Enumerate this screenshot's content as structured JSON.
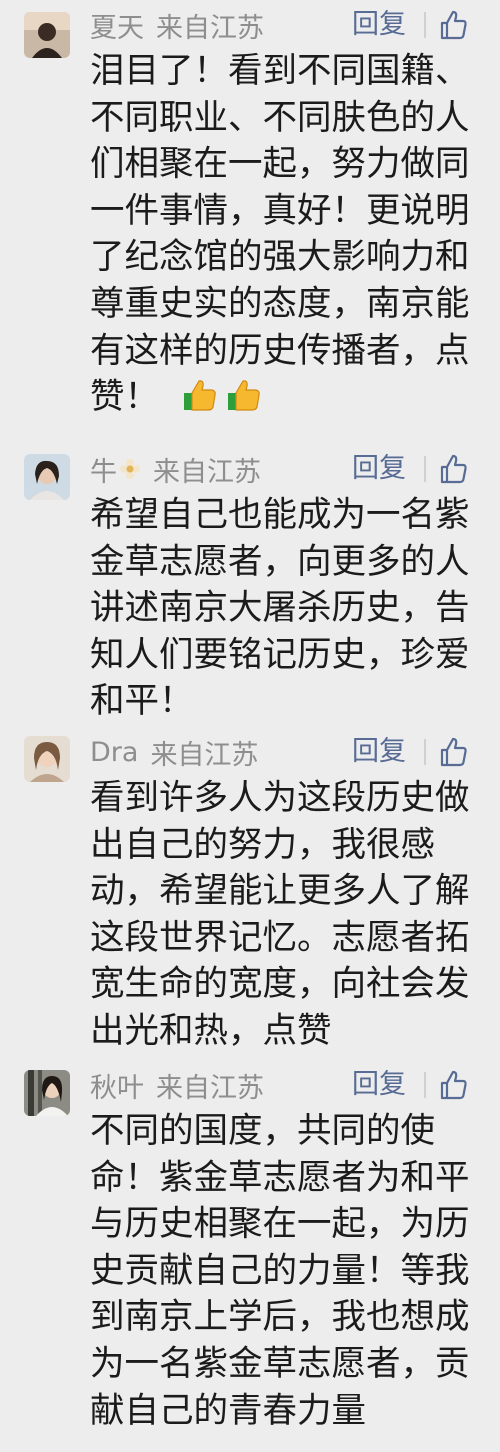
{
  "comments": [
    {
      "nickname": "夏天",
      "from": "来自江苏",
      "reply_label": "回复",
      "lines": [
        "泪目了！看到不同国籍、",
        "不同职业、不同肤色的人",
        "们相聚在一起，努力做同",
        "一件事情，真好！更说明",
        "了纪念馆的强大影响力和",
        "尊重史实的态度，南京能",
        "有这样的历史传播者，点",
        "赞！"
      ],
      "trailing_emojis": [
        "thumbs-up-emoji",
        "thumbs-up-emoji"
      ]
    },
    {
      "nickname": "牛",
      "nickname_icon": "flower-emoji",
      "from": "来自江苏",
      "reply_label": "回复",
      "lines": [
        "希望自己也能成为一名紫",
        "金草志愿者，向更多的人",
        "讲述南京大屠杀历史，告",
        "知人们要铭记历史，珍爱",
        "和平！"
      ]
    },
    {
      "nickname": "Dra",
      "from": "来自江苏",
      "reply_label": "回复",
      "lines": [
        "看到许多人为这段历史做",
        "出自己的努力，我很感",
        "动，希望能让更多人了解",
        "这段世界记忆。志愿者拓",
        "宽生命的宽度，向社会发",
        "出光和热，点赞"
      ]
    },
    {
      "nickname": "秋叶",
      "from": "来自江苏",
      "reply_label": "回复",
      "lines": [
        "不同的国度，共同的使",
        "命！紫金草志愿者为和平",
        "与历史相聚在一起，为历",
        "史贡献自己的力量！等我",
        "到南京上学后，我也想成",
        "为一名紫金草志愿者，贡",
        "献自己的青春力量"
      ]
    }
  ],
  "colors": {
    "background": "#ededed",
    "meta_gray": "#8e8e8e",
    "reply_blue": "#576b95",
    "text": "#1b1b1b"
  }
}
